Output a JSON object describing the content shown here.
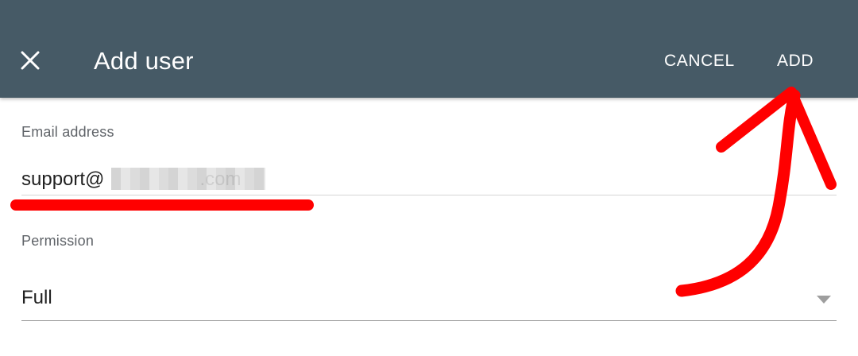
{
  "header": {
    "title": "Add user",
    "cancel_label": "CANCEL",
    "add_label": "ADD",
    "close_icon": "close-icon"
  },
  "form": {
    "email": {
      "label": "Email address",
      "value": "support@                  .com"
    },
    "permission": {
      "label": "Permission",
      "value": "Full"
    }
  },
  "colors": {
    "header_bg": "#465a66",
    "annotation": "#ff0000"
  }
}
